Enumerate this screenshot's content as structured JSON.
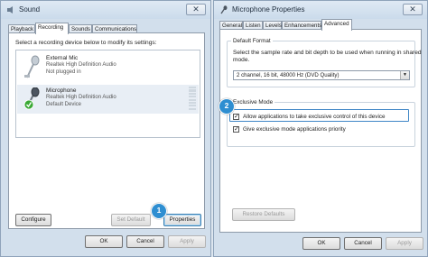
{
  "left_window": {
    "title": "Sound",
    "close_glyph": "✕",
    "tabs": [
      "Playback",
      "Recording",
      "Sounds",
      "Communications"
    ],
    "active_tab": "Recording",
    "instruction": "Select a recording device below to modify its settings:",
    "devices": [
      {
        "name": "External Mic",
        "driver": "Realtek High Definition Audio",
        "status": "Not plugged in",
        "icon": "microphone-icon"
      },
      {
        "name": "Microphone",
        "driver": "Realtek High Definition Audio",
        "status": "Default Device",
        "icon": "microphone-icon",
        "selected": true
      }
    ],
    "buttons": {
      "configure": "Configure",
      "set_default": "Set Default",
      "properties": "Properties",
      "ok": "OK",
      "cancel": "Cancel",
      "apply": "Apply"
    }
  },
  "right_window": {
    "title": "Microphone Properties",
    "close_glyph": "✕",
    "tabs": [
      "General",
      "Listen",
      "Levels",
      "Enhancements",
      "Advanced"
    ],
    "active_tab": "Advanced",
    "default_format": {
      "group_label": "Default Format",
      "description_line1": "Select the sample rate and bit depth to be used when running in shared",
      "description_line2": "mode.",
      "selected_value": "2 channel, 16 bit, 48000 Hz (DVD Quality)"
    },
    "exclusive_mode": {
      "group_label": "Exclusive Mode",
      "options": [
        {
          "label": "Allow applications to take exclusive control of this device",
          "checked": true
        },
        {
          "label": "Give exclusive mode applications priority",
          "checked": true
        }
      ]
    },
    "buttons": {
      "restore_defaults": "Restore Defaults",
      "ok": "OK",
      "cancel": "Cancel",
      "apply": "Apply"
    }
  },
  "callouts": {
    "one": "1",
    "two": "2"
  },
  "colors": {
    "accent": "#2e8ed1",
    "check_green": "#3aa935",
    "highlight_border": "#3f86c6"
  }
}
